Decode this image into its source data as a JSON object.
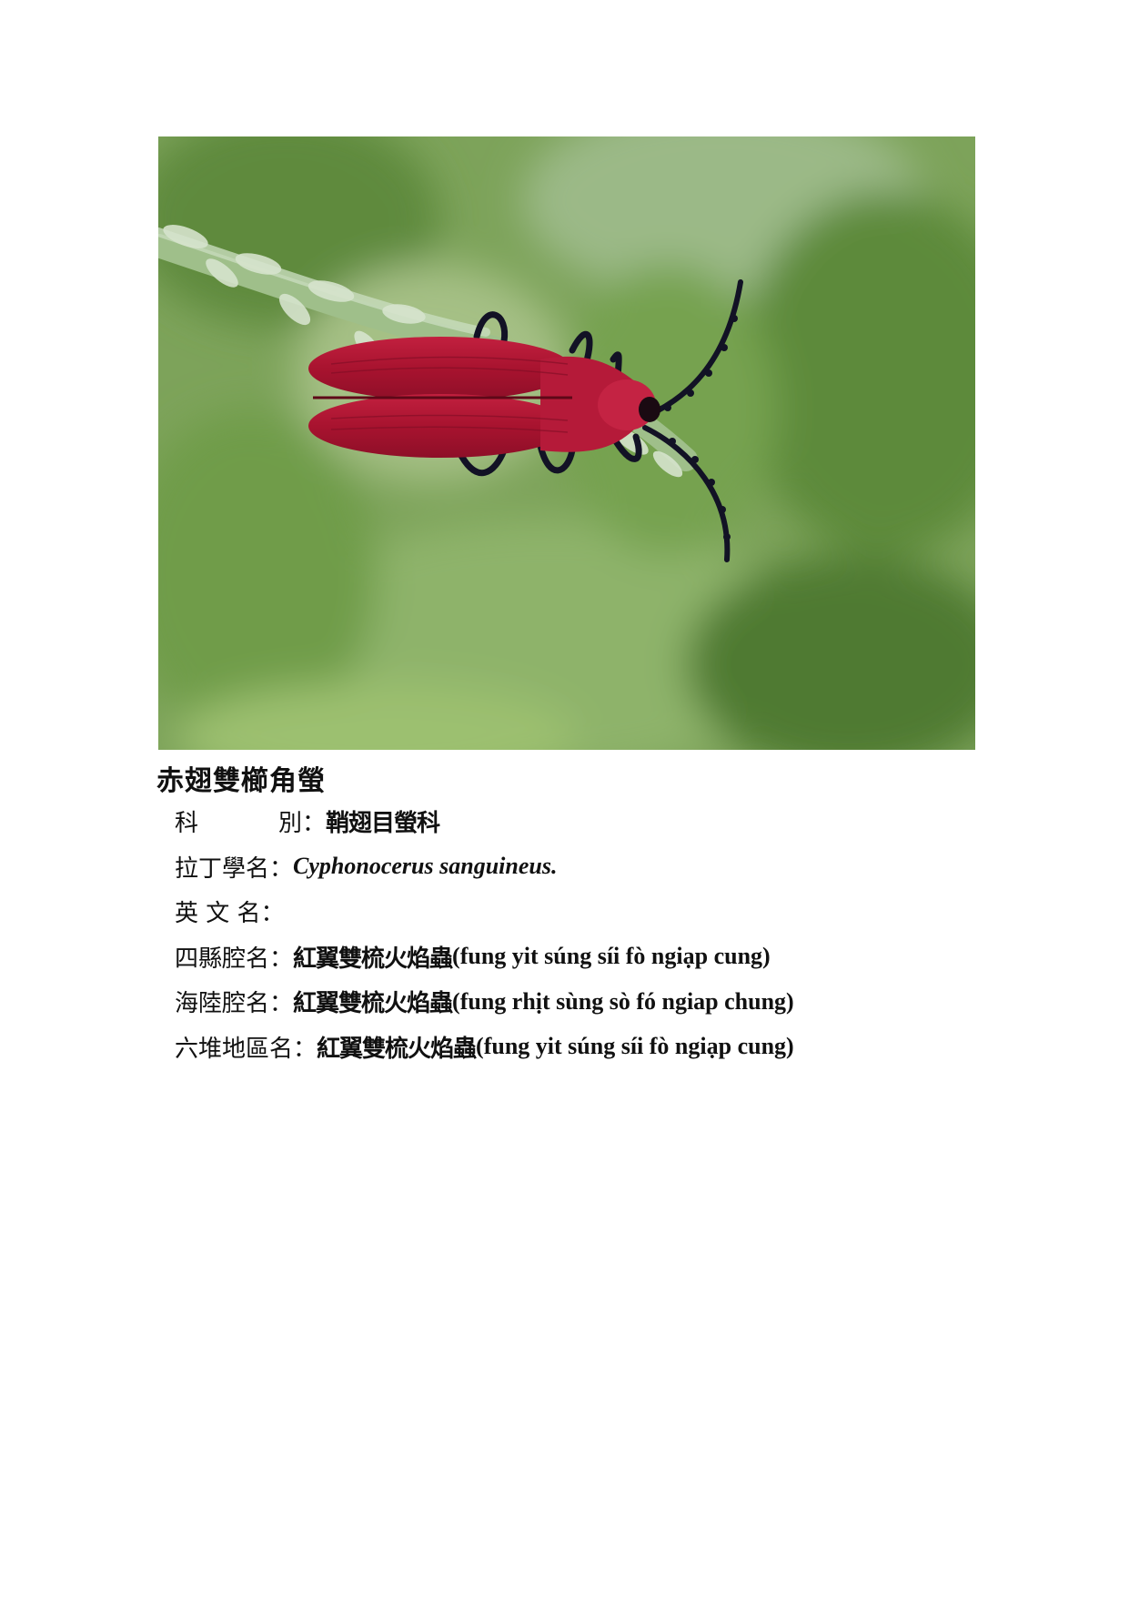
{
  "title": "赤翅雙櫛角螢",
  "rows": [
    {
      "label": "科　　別",
      "colon": "：",
      "value": "鞘翅目螢科"
    },
    {
      "label": "拉丁學名",
      "colon": "：",
      "value": "Cyphonocerus sanguineus."
    },
    {
      "label": "英 文 名",
      "colon": "：",
      "value": ""
    },
    {
      "label": "四縣腔名",
      "colon": "：",
      "value_cn": "紅翼雙梳火焰蟲",
      "value_rom": "(fung yit súng síi fò ngiạp cung)"
    },
    {
      "label": "海陸腔名",
      "colon": "：",
      "value_cn": "紅翼雙梳火焰蟲",
      "value_rom": "(fung rhịt sùng sò fó ngiap chung)"
    },
    {
      "label": "六堆地區名",
      "colon": "：",
      "value_cn": "紅翼雙梳火焰蟲",
      "value_rom": "(fung yit súng síi fò ngiạp cung)"
    }
  ],
  "photo": {
    "subject_icon": "red-beetle-on-grass-photo",
    "colors": {
      "beetle": "#b01636",
      "background": "#6f9a4e"
    }
  }
}
